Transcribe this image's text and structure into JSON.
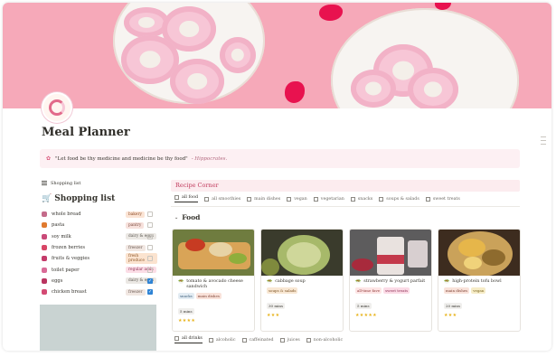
{
  "page": {
    "title": "Meal Planner",
    "quote_text": "\"Let food be thy medicine and medicine be thy food\"",
    "quote_author": "- Hippocrates."
  },
  "shopping": {
    "view_tab": "Shopping list",
    "title": "Shopping list",
    "items": [
      {
        "name": "whole bread",
        "tag": "bakery",
        "tag_bg": "#fbe4d5",
        "tag_fg": "#8c4b26",
        "icon_color": "#c46b8a",
        "checked": false
      },
      {
        "name": "pasta",
        "tag": "pantry",
        "tag_bg": "#f7e1dc",
        "tag_fg": "#7a4a3e",
        "icon_color": "#e07a2f",
        "checked": false
      },
      {
        "name": "soy milk",
        "tag": "dairy & eggs",
        "tag_bg": "#ebe8e4",
        "tag_fg": "#5f5b55",
        "icon_color": "#c94a78",
        "checked": false
      },
      {
        "name": "frozen berries",
        "tag": "freezer",
        "tag_bg": "#f1e7e2",
        "tag_fg": "#6b5a52",
        "icon_color": "#d84666",
        "checked": false
      },
      {
        "name": "fruits & veggies",
        "tag": "fresh produce",
        "tag_bg": "#fbe3cf",
        "tag_fg": "#8a5426",
        "icon_color": "#c43b6a",
        "checked": false
      },
      {
        "name": "toilet paper",
        "tag": "regular adds",
        "tag_bg": "#fbdde6",
        "tag_fg": "#8f3657",
        "icon_color": "#d96b97",
        "checked": false
      },
      {
        "name": "eggs",
        "tag": "dairy & eggs",
        "tag_bg": "#ebe8e4",
        "tag_fg": "#5f5b55",
        "icon_color": "#b93460",
        "checked": true
      },
      {
        "name": "chicken breast",
        "tag": "freezer",
        "tag_bg": "#f1e7e2",
        "tag_fg": "#6b5a52",
        "icon_color": "#d34a73",
        "checked": true
      }
    ]
  },
  "recipes": {
    "title": "Recipe Corner",
    "tabs": [
      "all food",
      "all smoothies",
      "main dishes",
      "vegan",
      "vegetarian",
      "snacks",
      "soups & salads",
      "sweet treats"
    ],
    "section": "Food",
    "cards": [
      {
        "name": "tomato & avocado cheese sandwich",
        "tags": [
          {
            "text": "snacks",
            "bg": "#e3ecf3",
            "fg": "#3d5e7a"
          },
          {
            "text": "main dishes",
            "bg": "#f9e2da",
            "fg": "#7d4437"
          }
        ],
        "time": "5 mins",
        "stars": "★★★★"
      },
      {
        "name": "cabbage soup",
        "tags": [
          {
            "text": "soups & salads",
            "bg": "#f8e7d3",
            "fg": "#7d5527"
          }
        ],
        "time": "30 mins",
        "stars": "★★★"
      },
      {
        "name": "strawberry & yogurt parfait",
        "tags": [
          {
            "text": "all-time fave",
            "bg": "#fde5e5",
            "fg": "#8f3a3a"
          },
          {
            "text": "sweet treats",
            "bg": "#fbdbe6",
            "fg": "#8c2f55"
          }
        ],
        "time": "5 mins",
        "stars": "★★★★★"
      },
      {
        "name": "high-protein tofu bowl",
        "tags": [
          {
            "text": "main dishes",
            "bg": "#f9e2da",
            "fg": "#7d4437"
          },
          {
            "text": "vegan",
            "bg": "#f6ecc7",
            "fg": "#7a6420"
          }
        ],
        "time": "20 mins",
        "stars": "★★★"
      }
    ],
    "drink_tabs": [
      "all drinks",
      "alcoholic",
      "caffeinated",
      "juices",
      "non-alcoholic"
    ]
  }
}
